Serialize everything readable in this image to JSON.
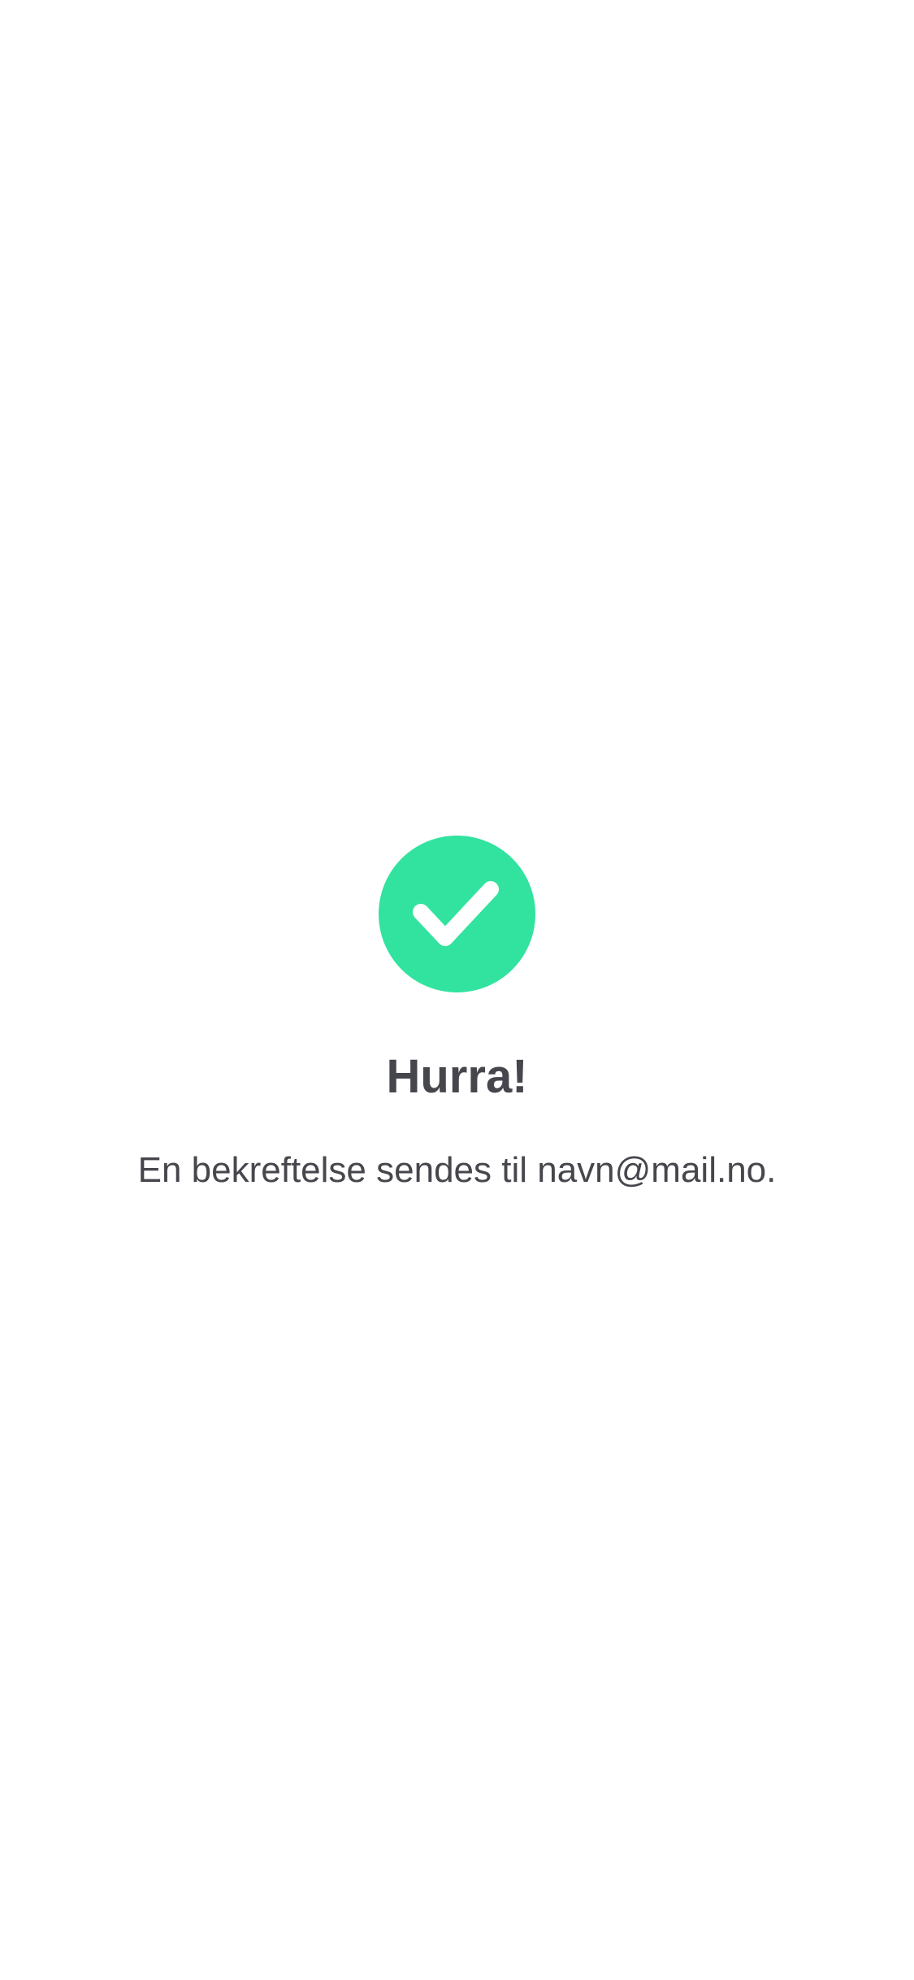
{
  "confirmation": {
    "icon": "checkmark-icon",
    "icon_color": "#32e39f",
    "title": "Hurra!",
    "message": "En bekreftelse sendes til navn@mail.no."
  }
}
